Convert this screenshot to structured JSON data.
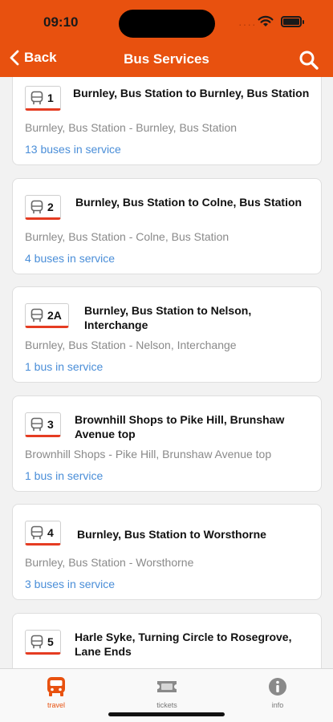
{
  "status_bar": {
    "time": "09:10"
  },
  "nav": {
    "back_label": "Back",
    "title": "Bus Services"
  },
  "services": [
    {
      "number": "1",
      "route": "Burnley, Bus Station to Burnley, Bus Station",
      "stops": "Burnley, Bus Station - Burnley, Bus Station",
      "count": "13 buses in service"
    },
    {
      "number": "2",
      "route": "Burnley, Bus Station to Colne, Bus Station",
      "stops": "Burnley, Bus Station - Colne, Bus Station",
      "count": "4 buses in service"
    },
    {
      "number": "2A",
      "route": "Burnley, Bus Station to Nelson, Interchange",
      "stops": "Burnley, Bus Station - Nelson, Interchange",
      "count": "1 bus in service"
    },
    {
      "number": "3",
      "route": "Brownhill Shops to Pike Hill, Brunshaw Avenue top",
      "stops": "Brownhill Shops - Pike Hill, Brunshaw Avenue top",
      "count": "1 bus in service"
    },
    {
      "number": "4",
      "route": "Burnley, Bus Station to Worsthorne",
      "stops": "Burnley, Bus Station - Worsthorne",
      "count": "3 buses in service"
    },
    {
      "number": "5",
      "route": "Harle Syke, Turning Circle to Rosegrove, Lane Ends",
      "stops": "",
      "count": ""
    }
  ],
  "tabs": [
    {
      "label": "travel",
      "icon": "bus-icon",
      "active": true
    },
    {
      "label": "tickets",
      "icon": "ticket-icon",
      "active": false
    },
    {
      "label": "info",
      "icon": "info-icon",
      "active": false
    }
  ],
  "colors": {
    "brand": "#e8510f",
    "link": "#4a8ed8",
    "badge_underline": "#e53c22"
  }
}
